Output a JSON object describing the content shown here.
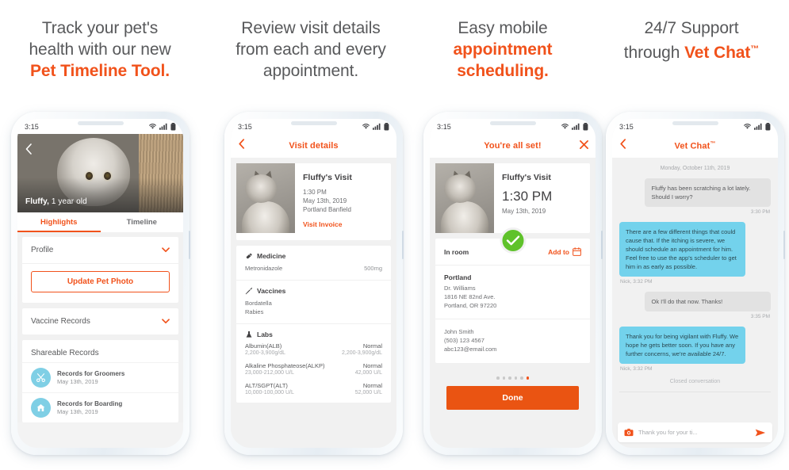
{
  "headings": [
    {
      "line1": "Track your pet's",
      "line2": "health with our new",
      "accent": "Pet Timeline Tool."
    },
    {
      "line1": "Review visit details",
      "line2": "from each and every",
      "line3": "appointment."
    },
    {
      "line1": "Easy mobile",
      "accent": "appointment scheduling."
    },
    {
      "line1": "24/7 Support",
      "line2pre": "through ",
      "accent": "Vet Chat",
      "tm": "™"
    }
  ],
  "colors": {
    "accent": "#f1521b",
    "text": "#58595b",
    "blue": "#73d2ec",
    "green": "#5fc22b",
    "icon_circle": "#7fcfe5"
  },
  "status_bar": {
    "time": "3:15"
  },
  "phone1": {
    "hero": {
      "pet_name": "Fluffy,",
      "pet_age": " 1 year old"
    },
    "tabs": [
      {
        "label": "Highlights",
        "active": true
      },
      {
        "label": "Timeline",
        "active": false
      }
    ],
    "profile_row": {
      "label": "Profile"
    },
    "update_photo_button": "Update Pet Photo",
    "vaccine_row": {
      "label": "Vaccine Records"
    },
    "shareable": {
      "title": "Shareable Records",
      "items": [
        {
          "icon": "scissors-icon",
          "title": "Records for Groomers",
          "date": "May 13th, 2019"
        },
        {
          "icon": "house-icon",
          "title": "Records for Boarding",
          "date": "May 13th, 2019"
        }
      ]
    }
  },
  "phone2": {
    "nav_title": "Visit details",
    "visit": {
      "title": "Fluffy's Visit",
      "time": "1:30 PM",
      "date": "May 13th, 2019",
      "clinic": "Portland Banfield",
      "link": "Visit Invoice"
    },
    "sections": [
      {
        "icon": "pill-icon",
        "title": "Medicine",
        "rows": [
          {
            "name": "Metronidazole",
            "value": "500mg"
          }
        ]
      },
      {
        "icon": "syringe-icon",
        "title": "Vaccines",
        "rows": [
          {
            "name": "Bordatella",
            "value": ""
          },
          {
            "name": "Rabies",
            "value": ""
          }
        ]
      }
    ],
    "labs": {
      "icon": "flask-icon",
      "title": "Labs",
      "items": [
        {
          "name": "Albumin(ALB)",
          "status": "Normal",
          "range": "2,200-3,900g/dL",
          "result": "2,200-3,900g/dL"
        },
        {
          "name": "Alkaline Phosphateose(ALKP)",
          "status": "Normal",
          "range": "23,000-212,000 U/L",
          "result": "42,000 U/L"
        },
        {
          "name": "ALT/SGPT(ALT)",
          "status": "Normal",
          "range": "10,000-100,000 U/L",
          "result": "52,000 U/L"
        }
      ]
    }
  },
  "phone3": {
    "nav_title": "You're all set!",
    "visit": {
      "title": "Fluffy's Visit",
      "time": "1:30 PM",
      "date": "May 13th, 2019"
    },
    "in_room_label": "In room",
    "add_to_label": "Add to",
    "clinic": {
      "name": "Portland",
      "doctor": "Dr. Williams",
      "street": "1816 NE 82nd Ave.",
      "city": "Portland, OR 97220"
    },
    "contact": {
      "name": "John Smith",
      "phone": "(503) 123 4567",
      "email": "abc123@email.com"
    },
    "pager": {
      "total": 6,
      "active": 6
    },
    "done_button": "Done"
  },
  "phone4": {
    "nav_title": "Vet Chat",
    "nav_title_tm": "™",
    "date": "Monday, October 11th, 2019",
    "messages": [
      {
        "side": "them",
        "text": "Fluffy has been scratching a lot lately. Should I worry?",
        "meta": "3:30 PM",
        "meta_align": "right"
      },
      {
        "side": "me",
        "text": "There are a few different things that could cause that. If the itching is severe, we should schedule an appointment for him. Feel free to use the app's scheduler to get him in as early as possible.",
        "meta": "Nick, 3:32 PM",
        "meta_align": "left"
      },
      {
        "side": "them",
        "text": "Ok I'll do that now. Thanks!",
        "meta": "3:35 PM",
        "meta_align": "right"
      },
      {
        "side": "me",
        "text": "Thank you for being vigilant with Fluffy. We hope he gets better soon. If you have any further concerns, we're available 24/7.",
        "meta": "Nick, 3:32 PM",
        "meta_align": "left"
      }
    ],
    "closed_label": "Closed conversation",
    "input_placeholder": "Thank you for your ti..."
  }
}
